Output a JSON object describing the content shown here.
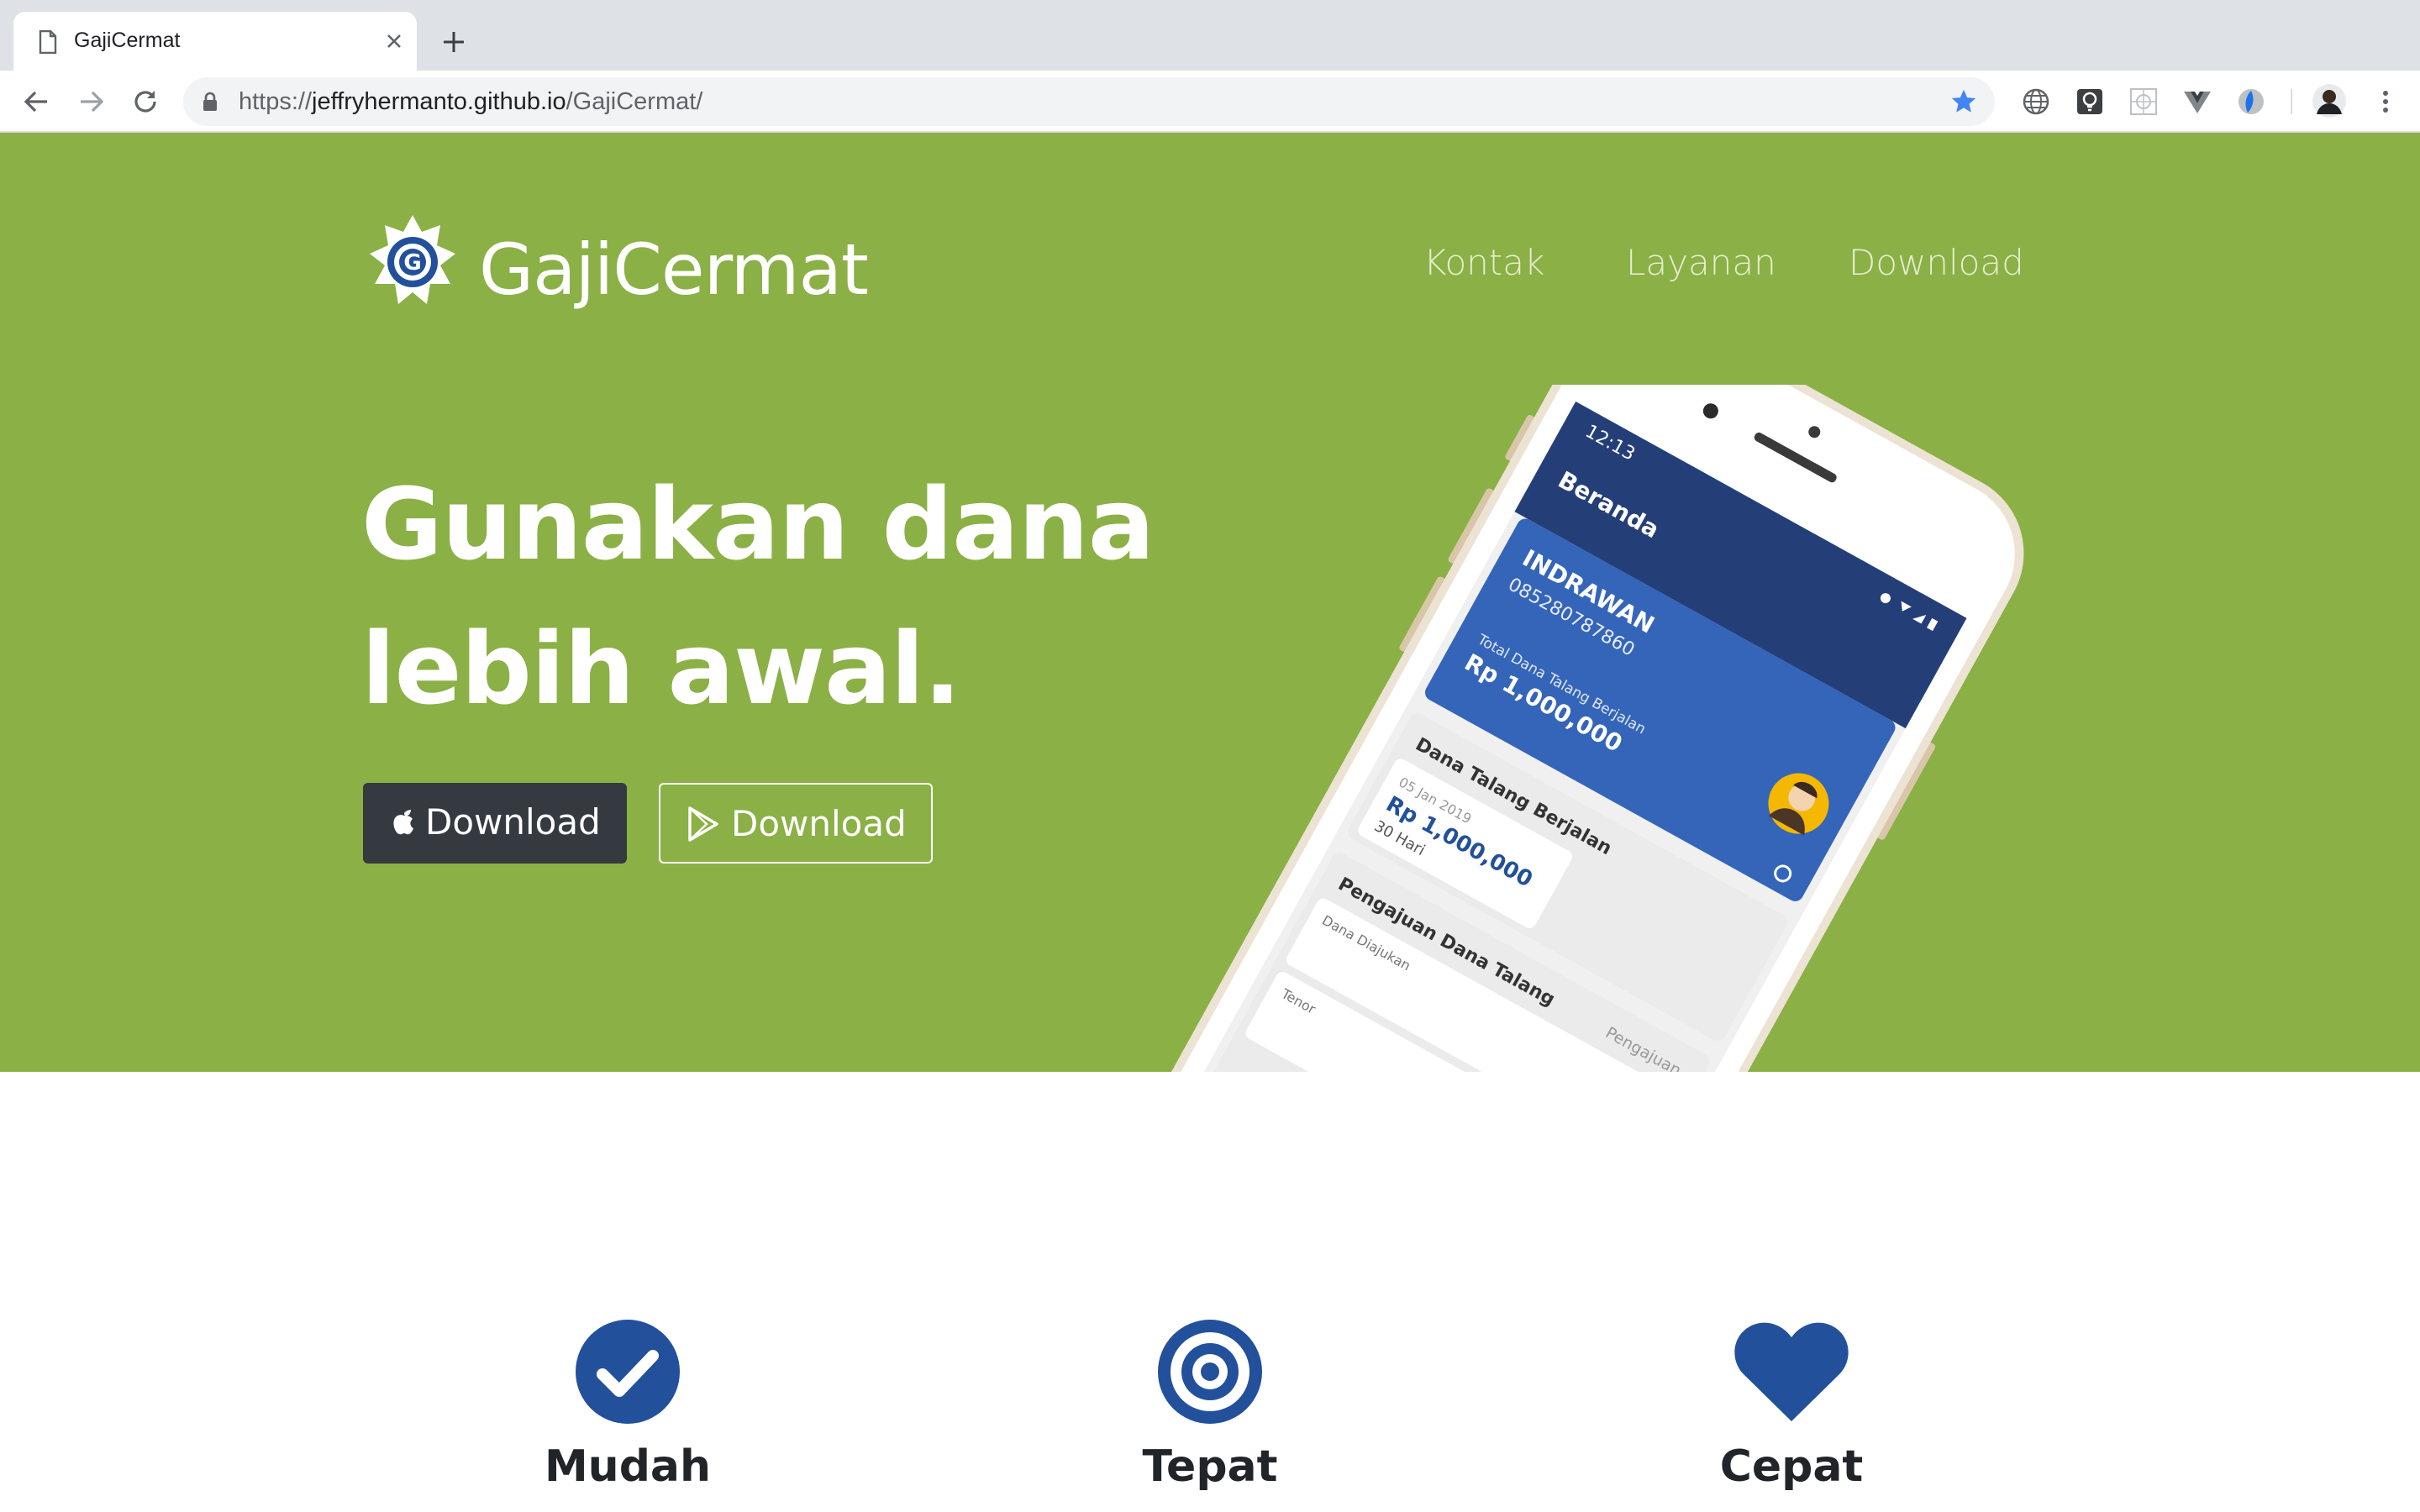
{
  "browser": {
    "tab_title": "GajiCermat",
    "url_scheme": "https://",
    "url_host": "jeffryhermanto.github.io",
    "url_path": "/GajiCermat/",
    "extensions": [
      "globe-icon",
      "lightbulb-icon",
      "grid-icon",
      "vue-icon",
      "shield-icon",
      "profile-avatar"
    ]
  },
  "site": {
    "brand": "GajiCermat",
    "nav": [
      "Kontak",
      "Layanan",
      "Download"
    ],
    "headline_line1": "Gunakan dana",
    "headline_line2": "lebih awal.",
    "buttons": {
      "ios": "Download",
      "android": "Download"
    }
  },
  "phone": {
    "time": "12:13",
    "screen_title": "Beranda",
    "card_name": "INDRAWAN",
    "card_phone": "085280787860",
    "card_total_label": "Total Dana Talang Berjalan",
    "card_total_value": "Rp 1,000,000",
    "section1_title": "Dana Talang Berjalan",
    "section1_date": "05 Jan 2019",
    "section1_amount": "Rp 1,000,000",
    "section1_tenor": "30 Hari",
    "section2_title": "Pengajuan Dana Talang",
    "section2_action": "Pengajuan",
    "section2_field1": "Dana Diajukan",
    "section2_field2": "Tenor"
  },
  "features": [
    {
      "title": "Mudah",
      "icon": "check-circle-icon"
    },
    {
      "title": "Tepat",
      "icon": "target-icon"
    },
    {
      "title": "Cepat",
      "icon": "heart-icon"
    }
  ],
  "colors": {
    "hero_green": "#8bb046",
    "brand_blue": "#23509b",
    "dark_button": "#343a40"
  }
}
